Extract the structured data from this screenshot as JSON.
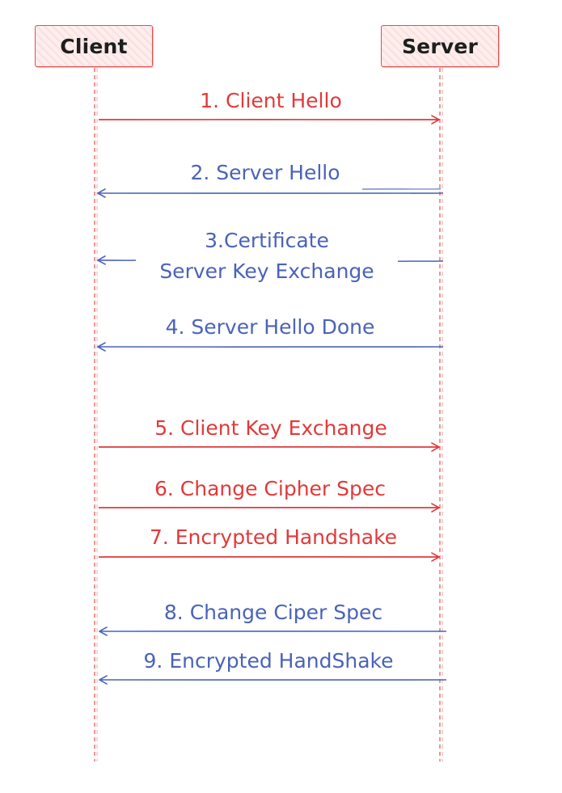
{
  "colors": {
    "lifeline": "#e85c5c",
    "client_to_server": "#e03a3a",
    "server_to_client": "#4a63b8",
    "box_border": "#e74c4c",
    "box_fill": "#fdeeee"
  },
  "participants": {
    "client": "Client",
    "server": "Server"
  },
  "messages": [
    {
      "label": "1. Client Hello",
      "direction": "client-to-server"
    },
    {
      "label": "2. Server Hello",
      "direction": "server-to-client"
    },
    {
      "label_lines": [
        "3.Certificate",
        "Server Key Exchange"
      ],
      "direction": "server-to-client"
    },
    {
      "label": "4. Server Hello Done",
      "direction": "server-to-client"
    },
    {
      "label": "5. Client Key Exchange",
      "direction": "client-to-server"
    },
    {
      "label": "6. Change Cipher Spec",
      "direction": "client-to-server"
    },
    {
      "label": "7. Encrypted Handshake",
      "direction": "client-to-server"
    },
    {
      "label": "8. Change Ciper Spec",
      "direction": "server-to-client"
    },
    {
      "label": "9. Encrypted HandShake",
      "direction": "server-to-client"
    }
  ]
}
